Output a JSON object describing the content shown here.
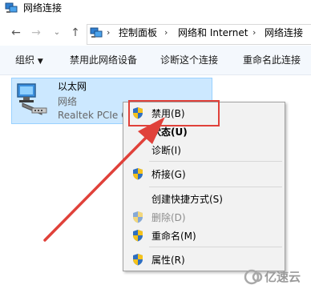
{
  "window": {
    "title": "网络连接"
  },
  "address": {
    "crumbs": [
      "控制面板",
      "网络和 Internet",
      "网络连接"
    ]
  },
  "toolbar": {
    "organize": "组织",
    "disable_device": "禁用此网络设备",
    "diagnose": "诊断这个连接",
    "rename": "重命名此连接"
  },
  "adapter": {
    "name": "以太网",
    "status": "网络",
    "description": "Realtek PCIe G"
  },
  "context_menu": {
    "disable": "禁用(B)",
    "status": "状态(U)",
    "diagnose": "诊断(I)",
    "bridge": "桥接(G)",
    "create_shortcut": "创建快捷方式(S)",
    "delete": "删除(D)",
    "rename": "重命名(M)",
    "properties": "属性(R)"
  },
  "watermark": {
    "text": "亿速云"
  },
  "colors": {
    "selection_fill": "#cce8ff",
    "selection_border": "#99d1ff",
    "annotation_red": "#e0413a",
    "menu_background": "#f2f2f2"
  }
}
